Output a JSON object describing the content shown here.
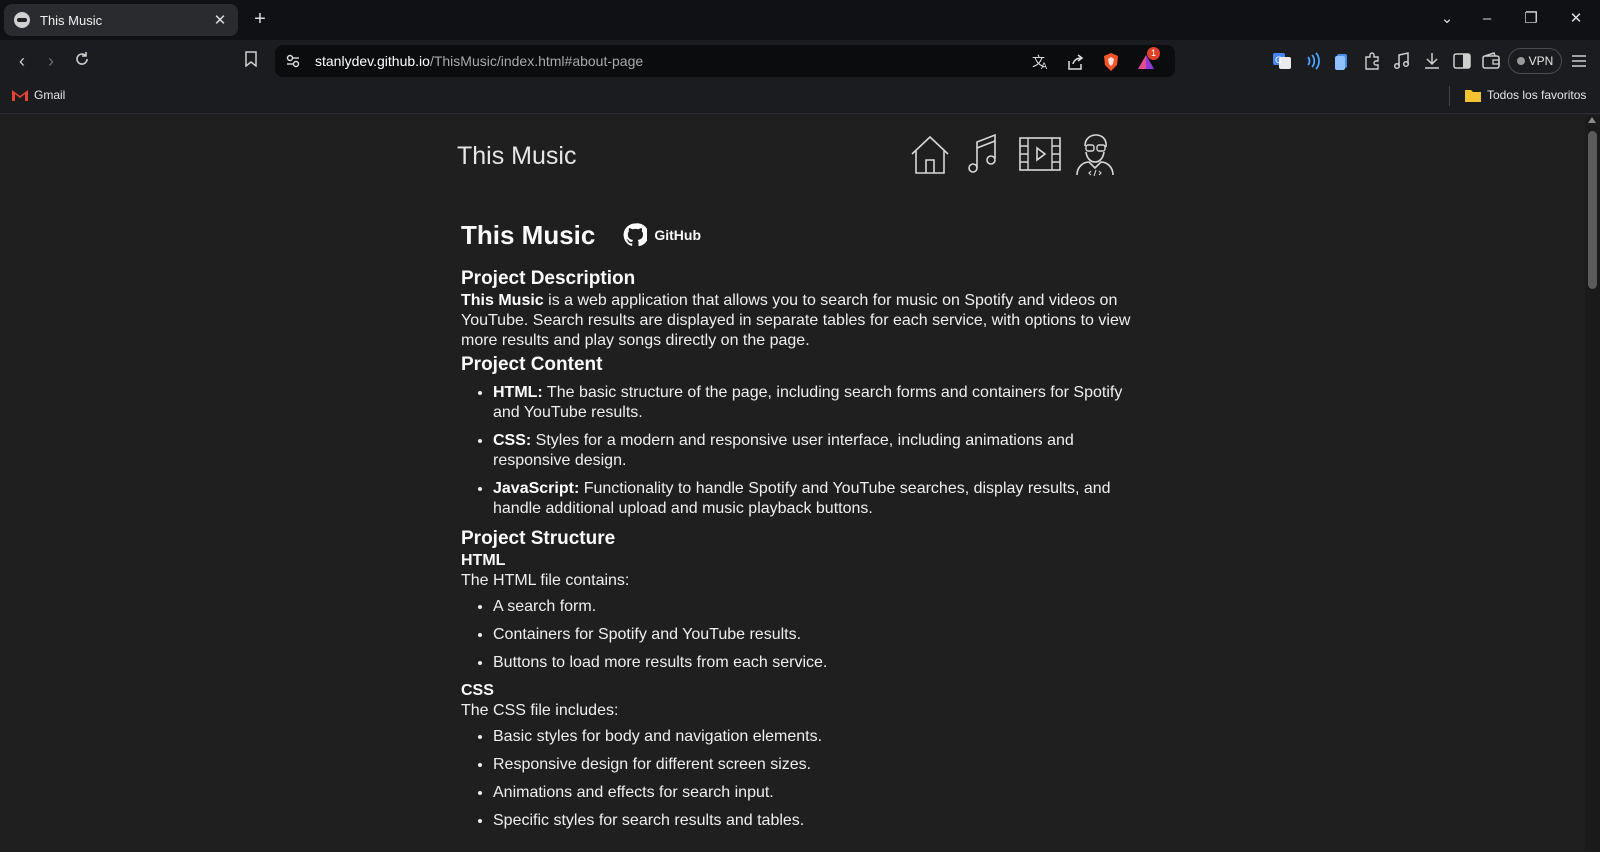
{
  "browser": {
    "tab": {
      "title": "This Music"
    },
    "address": {
      "host": "stanlydev.github.io",
      "path": "/ThisMusic/index.html#about-page"
    },
    "vpn_label": "VPN",
    "alert_badge": "1",
    "bookmarks": {
      "gmail": "Gmail",
      "all_favorites": "Todos los favoritos"
    }
  },
  "site": {
    "brand": "This Music",
    "nav": [
      {
        "icon": "home-icon"
      },
      {
        "icon": "music-note-icon"
      },
      {
        "icon": "video-icon"
      },
      {
        "icon": "developer-icon"
      }
    ]
  },
  "about": {
    "title": "This Music",
    "github_label": "GitHub",
    "description_heading": "Project Description",
    "description_strong": "This Music",
    "description_text": " is a web application that allows you to search for music on Spotify and videos on YouTube. Search results are displayed in separate tables for each service, with options to view more results and play songs directly on the page.",
    "content_heading": "Project Content",
    "content_items": [
      {
        "term": "HTML:",
        "text": " The basic structure of the page, including search forms and containers for Spotify and YouTube results."
      },
      {
        "term": "CSS:",
        "text": " Styles for a modern and responsive user interface, including animations and responsive design."
      },
      {
        "term": "JavaScript:",
        "text": " Functionality to handle Spotify and YouTube searches, display results, and handle additional upload and music playback buttons."
      }
    ],
    "structure_heading": "Project Structure",
    "html_subheading": "HTML",
    "html_intro": "The HTML file contains:",
    "html_items": [
      "A search form.",
      "Containers for Spotify and YouTube results.",
      "Buttons to load more results from each service."
    ],
    "css_subheading": "CSS",
    "css_intro": "The CSS file includes:",
    "css_items": [
      "Basic styles for body and navigation elements.",
      "Responsive design for different screen sizes.",
      "Animations and effects for search input.",
      "Specific styles for search results and tables."
    ]
  },
  "colors": {
    "page_bg": "#1f1f1f",
    "chrome_bg": "#1b1c1f",
    "tabbar_bg": "#101114",
    "text": "#efefef"
  }
}
